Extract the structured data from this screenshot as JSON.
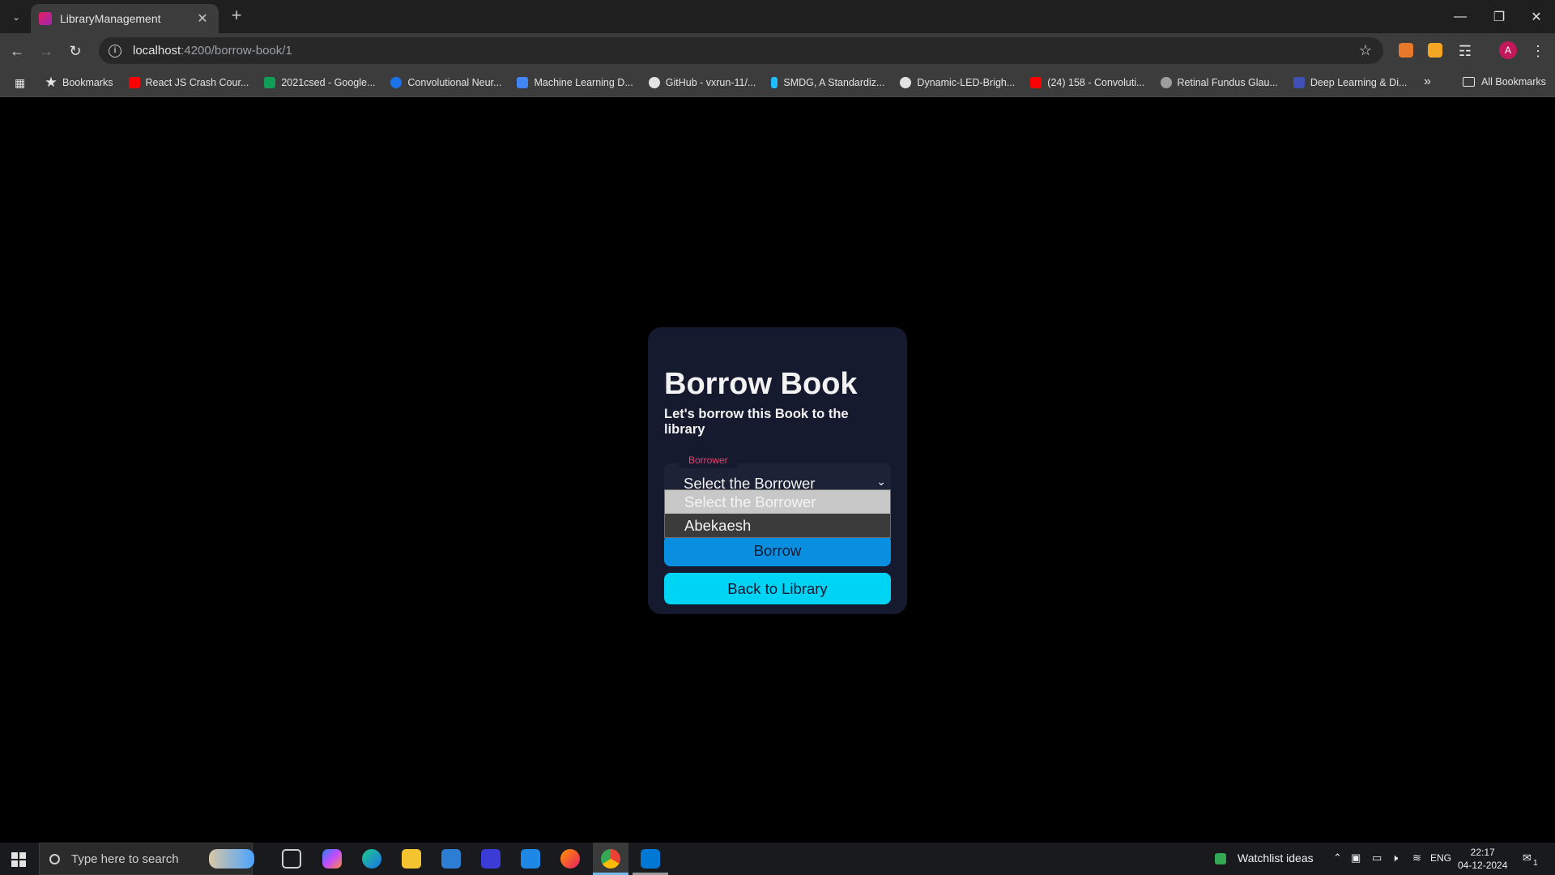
{
  "browser": {
    "tab_title": "LibraryManagement",
    "url_host": "localhost",
    "url_path": ":4200/borrow-book/1",
    "bookmarks": [
      {
        "label": "Bookmarks",
        "color": "#e3e3e3"
      },
      {
        "label": "React JS Crash Cour...",
        "color": "#ff0000"
      },
      {
        "label": "2021csed - Google...",
        "color": "#0f9d58"
      },
      {
        "label": "Convolutional Neur...",
        "color": "#1a73e8"
      },
      {
        "label": "Machine Learning D...",
        "color": "#4285f4"
      },
      {
        "label": "GitHub - vxrun-11/...",
        "color": "#e3e3e3"
      },
      {
        "label": "SMDG, A Standardiz...",
        "color": "#20beff"
      },
      {
        "label": "Dynamic-LED-Brigh...",
        "color": "#e3e3e3"
      },
      {
        "label": "(24) 158 - Convoluti...",
        "color": "#ff0000"
      },
      {
        "label": "Retinal Fundus Glau...",
        "color": "#9e9e9e"
      },
      {
        "label": "Deep Learning & Di...",
        "color": "#3f51b5"
      }
    ],
    "all_bookmarks": "All Bookmarks",
    "profile_initial": "A"
  },
  "page": {
    "title": "Borrow Book",
    "subtitle": "Let's borrow this Book to the library",
    "borrower_label": "Borrower",
    "borrower_value": "Select the Borrower",
    "dropdown_options": [
      "Select the Borrower",
      "Abekaesh"
    ],
    "borrow_button": "Borrow",
    "back_button": "Back to Library"
  },
  "taskbar": {
    "search_placeholder": "Type here to search",
    "watchlist": "Watchlist ideas",
    "language": "ENG",
    "time": "22:17",
    "date": "04-12-2024",
    "notification_count": "1"
  },
  "colors": {
    "card_bg": "#151a2e",
    "label_accent": "#e8416d",
    "borrow_btn": "#0a8fe0",
    "back_btn": "#00d4f5"
  }
}
